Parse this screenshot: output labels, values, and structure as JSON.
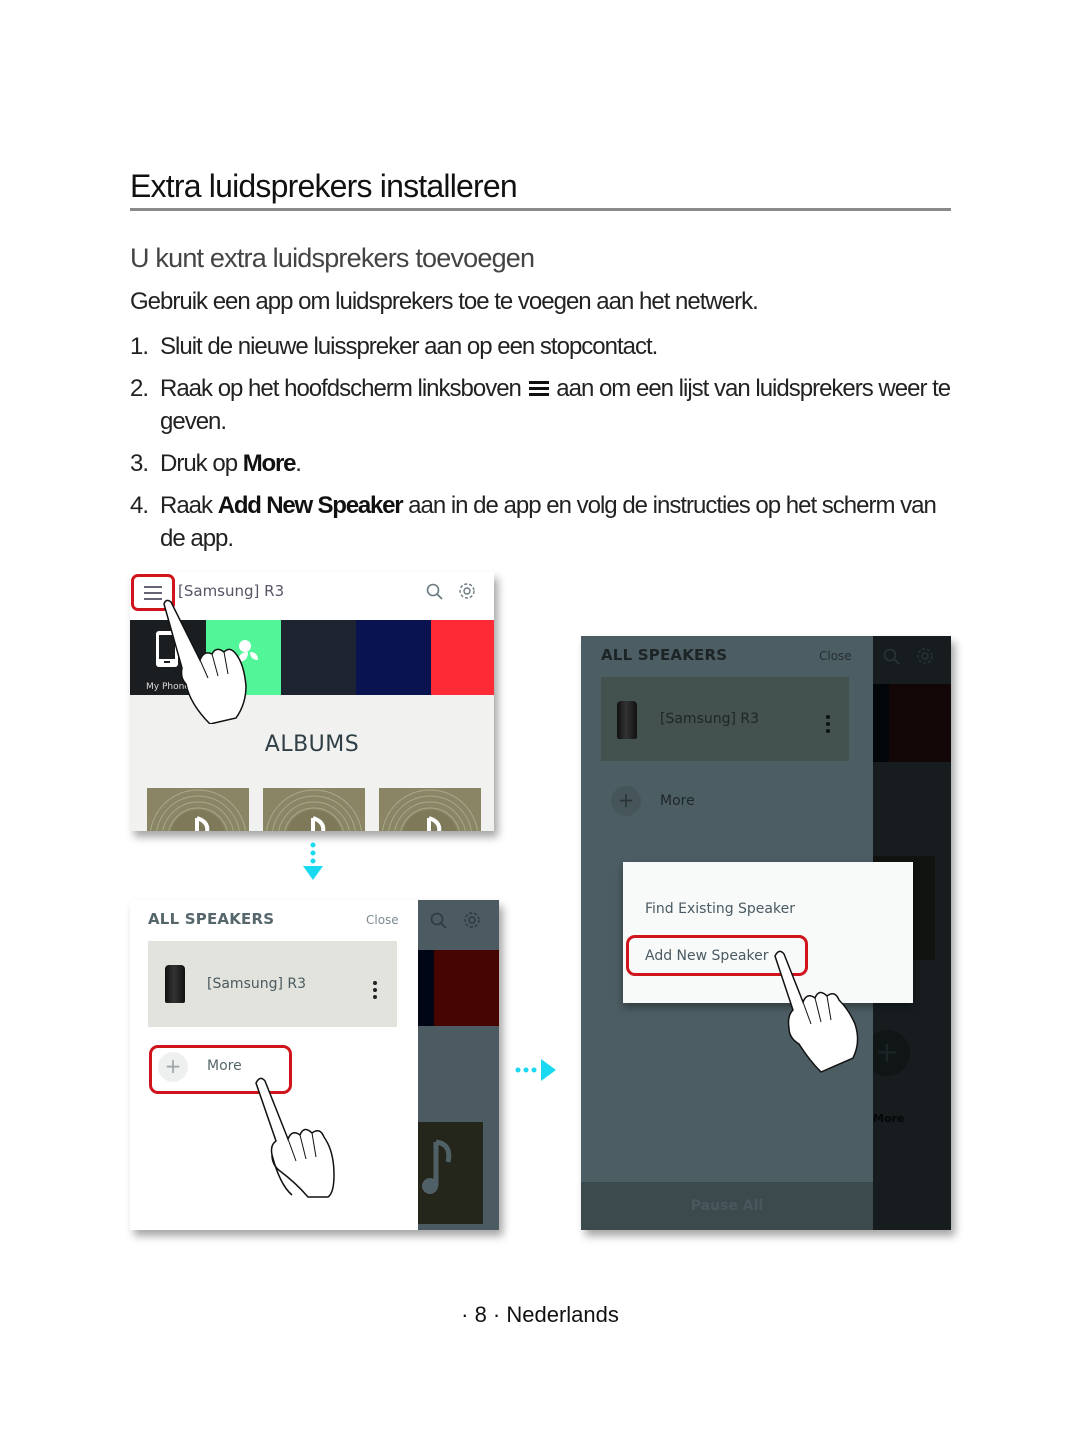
{
  "document": {
    "title": "Extra luidsprekers installeren",
    "subtitle": "U kunt extra luidsprekers toevoegen",
    "intro": "Gebruik een app om luidsprekers toe te voegen aan het netwerk.",
    "steps": [
      {
        "num": "1.",
        "text": "Sluit de nieuwe luisspreker aan op een stopcontact."
      },
      {
        "num": "2.",
        "text_before": "Raak op het hoofdscherm linksboven",
        "icon": "menu-icon",
        "text_after": "aan om een lijst van luidsprekers weer te geven."
      },
      {
        "num": "3.",
        "text_before": "Druk op",
        "bold": "More",
        "text_after": "."
      },
      {
        "num": "4.",
        "text_before": "Raak",
        "bold": "Add New Speaker",
        "text_after": "aan in de app en volg de instructies op het scherm van de app."
      }
    ],
    "footer": "· 8 · Nederlands"
  },
  "screen1": {
    "app_title": "[Samsung] R3",
    "icons": [
      "menu-icon",
      "search-icon",
      "gear-icon"
    ],
    "tiles": [
      {
        "label": "My Phone",
        "color": "#1b1e20"
      },
      {
        "label": "",
        "color": "#52f597"
      },
      {
        "label": "",
        "color": "#1e2330"
      },
      {
        "label": "",
        "color": "#08134f"
      },
      {
        "label": "",
        "color": "#fe2a35"
      }
    ],
    "section_heading": "ALBUMS",
    "highlight_color": "#d0141c"
  },
  "screen2": {
    "drawer_title": "ALL SPEAKERS",
    "close_label": "Close",
    "speaker_name": "[Samsung] R3",
    "more_label": "More"
  },
  "screen3": {
    "drawer_title": "ALL SPEAKERS",
    "close_label": "Close",
    "speaker_name": "[Samsung] R3",
    "more_label": "More",
    "popup_items": [
      "Find Existing Speaker",
      "Add New Speaker"
    ],
    "background_more_label": "More",
    "pause_all_label": "Pause All"
  },
  "colors": {
    "accent_arrow": "#19d9f0",
    "highlight": "#d0141c"
  }
}
